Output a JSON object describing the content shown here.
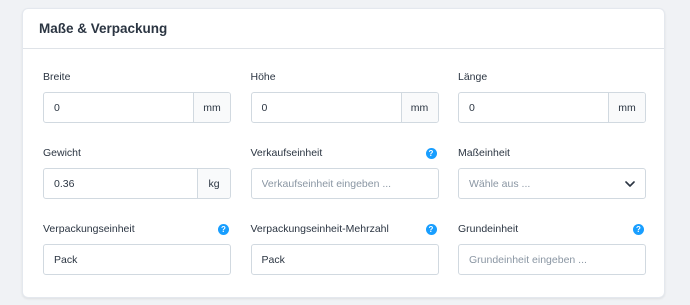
{
  "card": {
    "title": "Maße & Verpackung"
  },
  "fields": {
    "width": {
      "label": "Breite",
      "value": "0",
      "unit": "mm"
    },
    "height": {
      "label": "Höhe",
      "value": "0",
      "unit": "mm"
    },
    "length": {
      "label": "Länge",
      "value": "0",
      "unit": "mm"
    },
    "weight": {
      "label": "Gewicht",
      "value": "0.36",
      "unit": "kg"
    },
    "sales_unit": {
      "label": "Verkaufseinheit",
      "value": "",
      "placeholder": "Verkaufseinheit eingeben ..."
    },
    "unit": {
      "label": "Maßeinheit",
      "selected": "Wähle aus ..."
    },
    "packaging_unit": {
      "label": "Verpackungseinheit",
      "value": "Pack",
      "placeholder": ""
    },
    "packaging_unit_plural": {
      "label": "Verpackungseinheit-Mehrzahl",
      "value": "Pack",
      "placeholder": ""
    },
    "base_unit": {
      "label": "Grundeinheit",
      "value": "",
      "placeholder": "Grundeinheit eingeben ..."
    }
  },
  "help_icon": {
    "glyph": "?",
    "color": "#189eff"
  }
}
